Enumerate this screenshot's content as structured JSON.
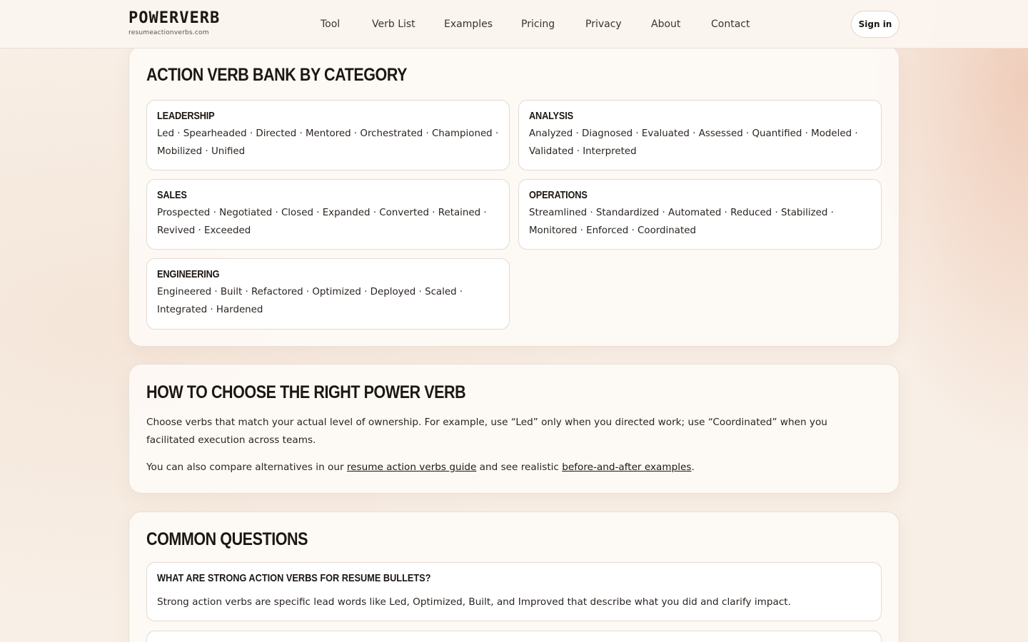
{
  "header": {
    "brand": "POWERVERB",
    "domain": "resumeactionverbs.com",
    "nav": [
      "Tool",
      "Verb List",
      "Examples",
      "Pricing",
      "Privacy",
      "About",
      "Contact"
    ],
    "signin_label": "Sign in"
  },
  "verb_bank": {
    "title": "ACTION VERB BANK BY CATEGORY",
    "categories": [
      {
        "name": "LEADERSHIP",
        "verbs": "Led · Spearheaded · Directed · Mentored · Orchestrated · Championed · Mobilized · Unified"
      },
      {
        "name": "ANALYSIS",
        "verbs": "Analyzed · Diagnosed · Evaluated · Assessed · Quantified · Modeled · Validated · Interpreted"
      },
      {
        "name": "SALES",
        "verbs": "Prospected · Negotiated · Closed · Expanded · Converted · Retained · Revived · Exceeded"
      },
      {
        "name": "OPERATIONS",
        "verbs": "Streamlined · Standardized · Automated · Reduced · Stabilized · Monitored · Enforced · Coordinated"
      },
      {
        "name": "ENGINEERING",
        "verbs": "Engineered · Built · Refactored · Optimized · Deployed · Scaled · Integrated · Hardened"
      }
    ]
  },
  "choose": {
    "title": "HOW TO CHOOSE THE RIGHT POWER VERB",
    "paragraph1": "Choose verbs that match your actual level of ownership. For example, use “Led” only when you directed work; use “Coordinated” when you facilitated execution across teams.",
    "p2_before": "You can also compare alternatives in our ",
    "p2_link1": "resume action verbs guide",
    "p2_middle": " and see realistic ",
    "p2_link2": "before-and-after examples",
    "p2_after": "."
  },
  "faq": {
    "title": "COMMON QUESTIONS",
    "items": [
      {
        "question": "WHAT ARE STRONG ACTION VERBS FOR RESUME BULLETS?",
        "answer": "Strong action verbs are specific lead words like Led, Optimized, Built, and Improved that describe what you did and clarify impact."
      }
    ]
  }
}
